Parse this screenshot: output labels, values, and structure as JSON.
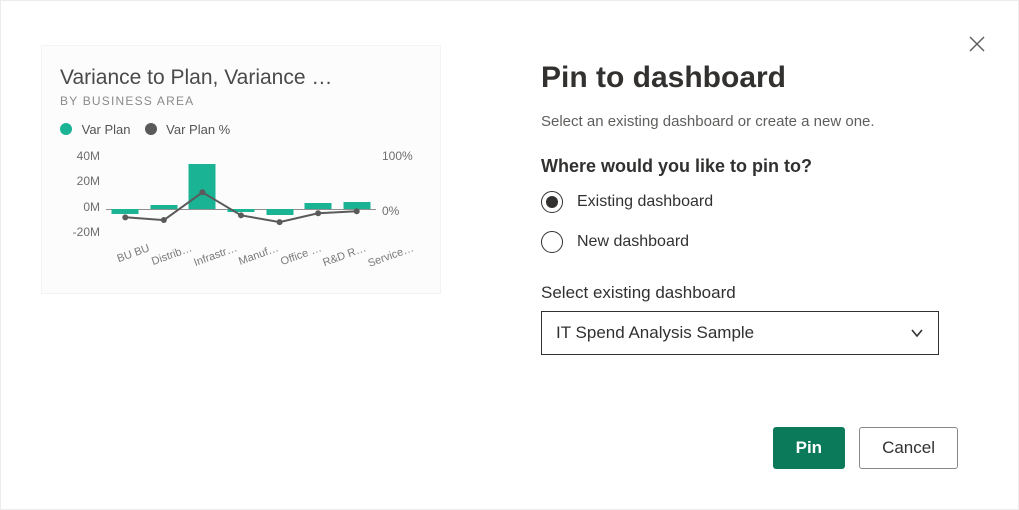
{
  "dialog": {
    "title": "Pin to dashboard",
    "subtitle": "Select an existing dashboard or create a new one.",
    "question": "Where would you like to pin to?",
    "options": {
      "existing": "Existing dashboard",
      "new": "New dashboard"
    },
    "selected_option": "existing",
    "select_label": "Select existing dashboard",
    "selected_dashboard": "IT Spend Analysis Sample",
    "actions": {
      "pin": "Pin",
      "cancel": "Cancel"
    }
  },
  "tile": {
    "title": "Variance to Plan, Variance …",
    "subtitle": "BY BUSINESS AREA",
    "legend": {
      "series1": "Var Plan",
      "series2": "Var Plan %"
    }
  },
  "chart_data": {
    "type": "bar+line",
    "categories": [
      "BU BU",
      "Distrib…",
      "Infrastr…",
      "Manuf…",
      "Office …",
      "R&D R…",
      "Service…"
    ],
    "y_left": {
      "label": "",
      "ticks": [
        "40M",
        "20M",
        "0M",
        "-20M"
      ],
      "lim": [
        -20,
        40
      ]
    },
    "y_right": {
      "label": "",
      "ticks": [
        "100%",
        "",
        "0%",
        ""
      ],
      "lim": [
        -33,
        100
      ]
    },
    "series": [
      {
        "name": "Var Plan",
        "type": "bar",
        "color": "#1ab394",
        "values": [
          -3,
          3,
          30,
          -2,
          -4,
          4,
          5
        ]
      },
      {
        "name": "Var Plan %",
        "type": "line",
        "color": "#5a5a5a",
        "values_pct": [
          -1,
          -5,
          36,
          2,
          -8,
          5,
          8
        ]
      }
    ]
  }
}
